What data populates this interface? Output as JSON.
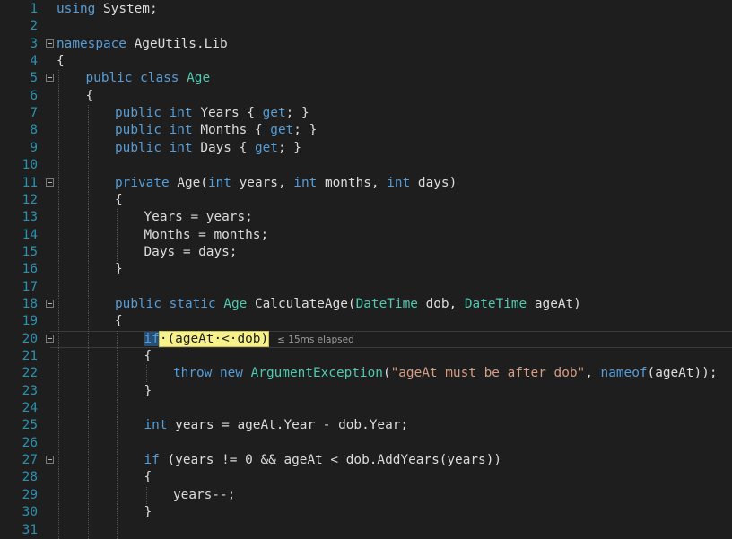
{
  "editor": {
    "lines": [
      {
        "num": "1",
        "fold": false,
        "depth": 0,
        "tokens": [
          {
            "t": "using",
            "c": "kw"
          },
          {
            "t": " System;",
            "c": "pl"
          }
        ]
      },
      {
        "num": "2",
        "fold": false,
        "depth": 0,
        "tokens": []
      },
      {
        "num": "3",
        "fold": true,
        "depth": 0,
        "tokens": [
          {
            "t": "namespace",
            "c": "kw"
          },
          {
            "t": " AgeUtils.Lib",
            "c": "pl"
          }
        ]
      },
      {
        "num": "4",
        "fold": false,
        "depth": 0,
        "tokens": [
          {
            "t": "{",
            "c": "pl"
          }
        ]
      },
      {
        "num": "5",
        "fold": true,
        "depth": 1,
        "tokens": [
          {
            "t": "public class ",
            "c": "kw"
          },
          {
            "t": "Age",
            "c": "ty"
          }
        ]
      },
      {
        "num": "6",
        "fold": false,
        "depth": 1,
        "tokens": [
          {
            "t": "{",
            "c": "pl"
          }
        ]
      },
      {
        "num": "7",
        "fold": false,
        "depth": 2,
        "tokens": [
          {
            "t": "public int ",
            "c": "kw"
          },
          {
            "t": "Years { ",
            "c": "pl"
          },
          {
            "t": "get",
            "c": "kw"
          },
          {
            "t": "; }",
            "c": "pl"
          }
        ]
      },
      {
        "num": "8",
        "fold": false,
        "depth": 2,
        "tokens": [
          {
            "t": "public int ",
            "c": "kw"
          },
          {
            "t": "Months { ",
            "c": "pl"
          },
          {
            "t": "get",
            "c": "kw"
          },
          {
            "t": "; }",
            "c": "pl"
          }
        ]
      },
      {
        "num": "9",
        "fold": false,
        "depth": 2,
        "tokens": [
          {
            "t": "public int ",
            "c": "kw"
          },
          {
            "t": "Days { ",
            "c": "pl"
          },
          {
            "t": "get",
            "c": "kw"
          },
          {
            "t": "; }",
            "c": "pl"
          }
        ]
      },
      {
        "num": "10",
        "fold": false,
        "depth": 2,
        "tokens": []
      },
      {
        "num": "11",
        "fold": true,
        "depth": 2,
        "tokens": [
          {
            "t": "private ",
            "c": "kw"
          },
          {
            "t": "Age(",
            "c": "pl"
          },
          {
            "t": "int",
            "c": "kw"
          },
          {
            "t": " years, ",
            "c": "pl"
          },
          {
            "t": "int",
            "c": "kw"
          },
          {
            "t": " months, ",
            "c": "pl"
          },
          {
            "t": "int",
            "c": "kw"
          },
          {
            "t": " days)",
            "c": "pl"
          }
        ]
      },
      {
        "num": "12",
        "fold": false,
        "depth": 2,
        "tokens": [
          {
            "t": "{",
            "c": "pl"
          }
        ]
      },
      {
        "num": "13",
        "fold": false,
        "depth": 3,
        "tokens": [
          {
            "t": "Years = years;",
            "c": "pl"
          }
        ]
      },
      {
        "num": "14",
        "fold": false,
        "depth": 3,
        "tokens": [
          {
            "t": "Months = months;",
            "c": "pl"
          }
        ]
      },
      {
        "num": "15",
        "fold": false,
        "depth": 3,
        "tokens": [
          {
            "t": "Days = days;",
            "c": "pl"
          }
        ]
      },
      {
        "num": "16",
        "fold": false,
        "depth": 2,
        "tokens": [
          {
            "t": "}",
            "c": "pl"
          }
        ]
      },
      {
        "num": "17",
        "fold": false,
        "depth": 2,
        "tokens": []
      },
      {
        "num": "18",
        "fold": true,
        "depth": 2,
        "tokens": [
          {
            "t": "public static ",
            "c": "kw"
          },
          {
            "t": "Age",
            "c": "ty"
          },
          {
            "t": " CalculateAge(",
            "c": "pl"
          },
          {
            "t": "DateTime",
            "c": "ty"
          },
          {
            "t": " dob, ",
            "c": "pl"
          },
          {
            "t": "DateTime",
            "c": "ty"
          },
          {
            "t": " ageAt)",
            "c": "pl"
          }
        ]
      },
      {
        "num": "19",
        "fold": false,
        "depth": 2,
        "tokens": [
          {
            "t": "{",
            "c": "pl"
          }
        ]
      },
      {
        "num": "20",
        "fold": true,
        "depth": 3,
        "current": true,
        "tokens": [
          {
            "t": "if",
            "c": "if"
          },
          {
            "t": "·(ageAt·<·dob)",
            "c": "cond"
          },
          {
            "t": "≤ 15ms elapsed",
            "c": "perf"
          }
        ]
      },
      {
        "num": "21",
        "fold": false,
        "depth": 3,
        "tokens": [
          {
            "t": "{",
            "c": "pl"
          }
        ]
      },
      {
        "num": "22",
        "fold": false,
        "depth": 4,
        "tokens": [
          {
            "t": "throw new ",
            "c": "kw"
          },
          {
            "t": "ArgumentException",
            "c": "ty"
          },
          {
            "t": "(",
            "c": "pl"
          },
          {
            "t": "\"ageAt must be after dob\"",
            "c": "str"
          },
          {
            "t": ", ",
            "c": "pl"
          },
          {
            "t": "nameof",
            "c": "kw"
          },
          {
            "t": "(ageAt));",
            "c": "pl"
          }
        ]
      },
      {
        "num": "23",
        "fold": false,
        "depth": 3,
        "tokens": [
          {
            "t": "}",
            "c": "pl"
          }
        ]
      },
      {
        "num": "24",
        "fold": false,
        "depth": 3,
        "tokens": []
      },
      {
        "num": "25",
        "fold": false,
        "depth": 3,
        "tokens": [
          {
            "t": "int",
            "c": "kw"
          },
          {
            "t": " years = ageAt.Year - dob.Year;",
            "c": "pl"
          }
        ]
      },
      {
        "num": "26",
        "fold": false,
        "depth": 3,
        "tokens": []
      },
      {
        "num": "27",
        "fold": true,
        "depth": 3,
        "tokens": [
          {
            "t": "if",
            "c": "kw"
          },
          {
            "t": " (years != 0 && ageAt < dob.AddYears(years))",
            "c": "pl"
          }
        ]
      },
      {
        "num": "28",
        "fold": false,
        "depth": 3,
        "tokens": [
          {
            "t": "{",
            "c": "pl"
          }
        ]
      },
      {
        "num": "29",
        "fold": false,
        "depth": 4,
        "tokens": [
          {
            "t": "years--;",
            "c": "pl"
          }
        ]
      },
      {
        "num": "30",
        "fold": false,
        "depth": 3,
        "tokens": [
          {
            "t": "}",
            "c": "pl"
          }
        ]
      },
      {
        "num": "31",
        "fold": false,
        "depth": 3,
        "tokens": []
      }
    ],
    "colors": {
      "background": "#1e1e1e",
      "line_number": "#2b91af",
      "keyword": "#569cd6",
      "type": "#4ec9b0",
      "string": "#d69d85",
      "plain": "#dcdcdc",
      "highlight": "#f7f18c"
    }
  }
}
